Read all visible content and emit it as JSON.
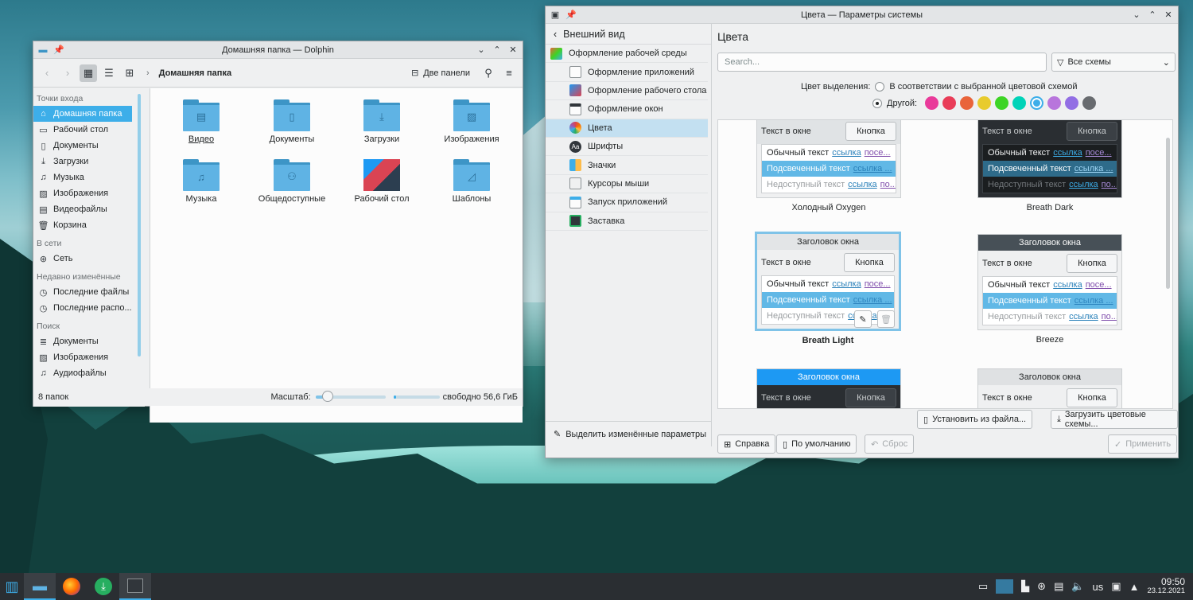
{
  "dolphin": {
    "title": "Домашняя папка — Dolphin",
    "breadcrumb": "Домашняя папка",
    "split_label": "Две панели",
    "places": {
      "h1": "Точки входа",
      "i1": "Домашняя папка",
      "i2": "Рабочий стол",
      "i3": "Документы",
      "i4": "Загрузки",
      "i5": "Музыка",
      "i6": "Изображения",
      "i7": "Видеофайлы",
      "i8": "Корзина",
      "h2": "В сети",
      "i9": "Сеть",
      "h3": "Недавно изменённые",
      "i10": "Последние файлы",
      "i11": "Последние распо...",
      "h4": "Поиск",
      "i12": "Документы",
      "i13": "Изображения",
      "i14": "Аудиофайлы"
    },
    "folders": {
      "f1": "Видео",
      "f2": "Документы",
      "f3": "Загрузки",
      "f4": "Изображения",
      "f5": "Музыка",
      "f6": "Общедоступные",
      "f7": "Рабочий стол",
      "f8": "Шаблоны"
    },
    "status": "8 папок",
    "zoom_label": "Масштаб:",
    "zoom_level": 0.18,
    "free_fraction": 0.05,
    "free": "свободно 56,6 ГиБ"
  },
  "settings": {
    "title": "Цвета — Параметры системы",
    "back_label": "Внешний вид",
    "categories": {
      "c1": "Оформление рабочей среды",
      "c2": "Оформление приложений",
      "c3": "Оформление рабочего стола",
      "c4": "Оформление окон",
      "c5": "Цвета",
      "c6": "Шрифты",
      "c7": "Значки",
      "c8": "Курсоры мыши",
      "c9": "Запуск приложений",
      "c10": "Заставка"
    },
    "highlight_changed": "Выделить изменённые параметры",
    "page_title": "Цвета",
    "search_placeholder": "Search...",
    "filter": "Все схемы",
    "accent_label": "Цвет выделения:",
    "accent_opt1": "В соответствии с выбранной цветовой схемой",
    "accent_opt2": "Другой:",
    "swatches": [
      "#e93a9a",
      "#e93d58",
      "#e9643a",
      "#e8cb2d",
      "#3dd425",
      "#00d3b8",
      "#3daee9",
      "#b875dc",
      "#926ee4",
      "#686b6f"
    ],
    "preview": {
      "window_text": "Текст в окне",
      "button": "Кнопка",
      "title": "Заголовок окна",
      "normal": "Обычный текст",
      "link": "ссылка",
      "visited": "посе...",
      "selected": "Подсвеченный текст",
      "link2": "ссылка ...",
      "disabled": "Недоступный текст",
      "dis_link": "по..."
    },
    "schemes": {
      "s1": "Холодный Oxygen",
      "s2": "Breath Dark",
      "s3": "Breath Light",
      "s4": "Breeze"
    },
    "install_file": "Установить из файла...",
    "get_new": "Загрузить цветовые схемы...",
    "help": "Справка",
    "defaults": "По умолчанию",
    "reset": "Сброс",
    "apply": "Применить"
  },
  "taskbar": {
    "layout": "us",
    "time": "09:50",
    "date": "23.12.2021"
  }
}
